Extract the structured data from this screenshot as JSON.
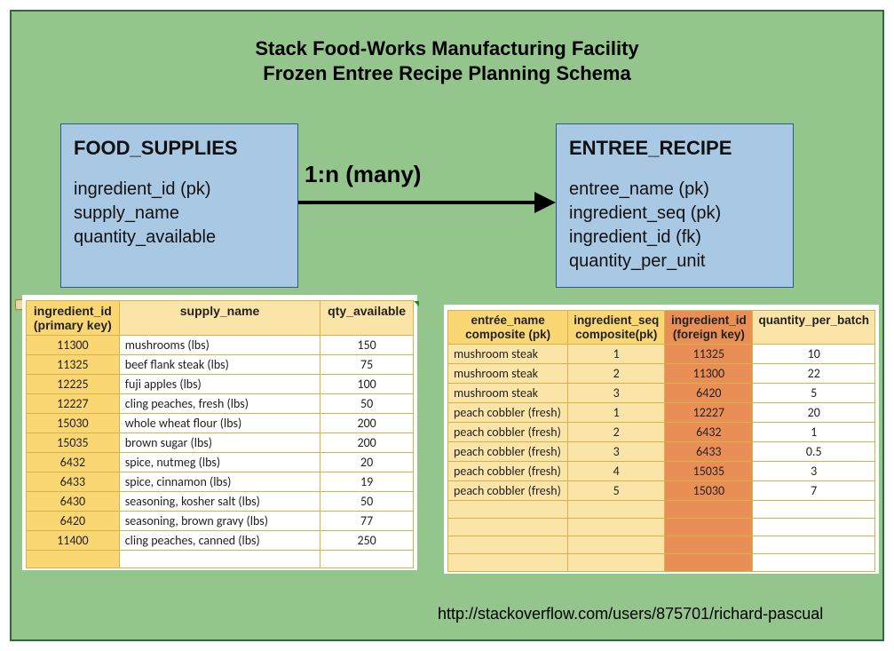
{
  "title": {
    "line1": "Stack Food-Works Manufacturing Facility",
    "line2": "Frozen Entree Recipe Planning Schema"
  },
  "relationship_label": "1:n (many)",
  "entities": {
    "food_supplies": {
      "name": "FOOD_SUPPLIES",
      "fields": [
        "ingredient_id (pk)",
        "supply_name",
        "quantity_available"
      ]
    },
    "entree_recipe": {
      "name": "ENTREE_RECIPE",
      "fields": [
        "entree_name (pk)",
        "ingredient_seq (pk)",
        "ingredient_id (fk)",
        "quantity_per_unit"
      ]
    }
  },
  "supplies_table": {
    "headers": {
      "c0": "ingredient_id (primary key)",
      "c1": "supply_name",
      "c2": "qty_available"
    },
    "rows": [
      {
        "id": "11300",
        "name": "mushrooms (lbs)",
        "qty": "150"
      },
      {
        "id": "11325",
        "name": "beef flank steak (lbs)",
        "qty": "75"
      },
      {
        "id": "12225",
        "name": "fuji apples (lbs)",
        "qty": "100"
      },
      {
        "id": "12227",
        "name": "cling peaches, fresh (lbs)",
        "qty": "50"
      },
      {
        "id": "15030",
        "name": "whole wheat flour (lbs)",
        "qty": "200"
      },
      {
        "id": "15035",
        "name": "brown sugar (lbs)",
        "qty": "200"
      },
      {
        "id": "6432",
        "name": "spice, nutmeg (lbs)",
        "qty": "20"
      },
      {
        "id": "6433",
        "name": "spice, cinnamon (lbs)",
        "qty": "19"
      },
      {
        "id": "6430",
        "name": "seasoning, kosher salt (lbs)",
        "qty": "50"
      },
      {
        "id": "6420",
        "name": "seasoning, brown gravy (lbs)",
        "qty": "77"
      },
      {
        "id": "11400",
        "name": "cling peaches, canned (lbs)",
        "qty": "250"
      }
    ]
  },
  "recipe_table": {
    "headers": {
      "c0": "entrée_name composite (pk)",
      "c1": "ingredient_seq composite(pk)",
      "c2": "ingredient_id (foreign key)",
      "c3": "quantity_per_batch"
    },
    "rows": [
      {
        "en": "mushroom steak",
        "seq": "1",
        "iid": "11325",
        "qty": "10"
      },
      {
        "en": "mushroom steak",
        "seq": "2",
        "iid": "11300",
        "qty": "22"
      },
      {
        "en": "mushroom steak",
        "seq": "3",
        "iid": "6420",
        "qty": "5"
      },
      {
        "en": "peach cobbler (fresh)",
        "seq": "1",
        "iid": "12227",
        "qty": "20"
      },
      {
        "en": "peach cobbler (fresh)",
        "seq": "2",
        "iid": "6432",
        "qty": "1"
      },
      {
        "en": "peach cobbler (fresh)",
        "seq": "3",
        "iid": "6433",
        "qty": "0.5"
      },
      {
        "en": "peach cobbler (fresh)",
        "seq": "4",
        "iid": "15035",
        "qty": "3"
      },
      {
        "en": "peach cobbler (fresh)",
        "seq": "5",
        "iid": "15030",
        "qty": "7"
      }
    ]
  },
  "footer_url": "http://stackoverflow.com/users/875701/richard-pascual"
}
